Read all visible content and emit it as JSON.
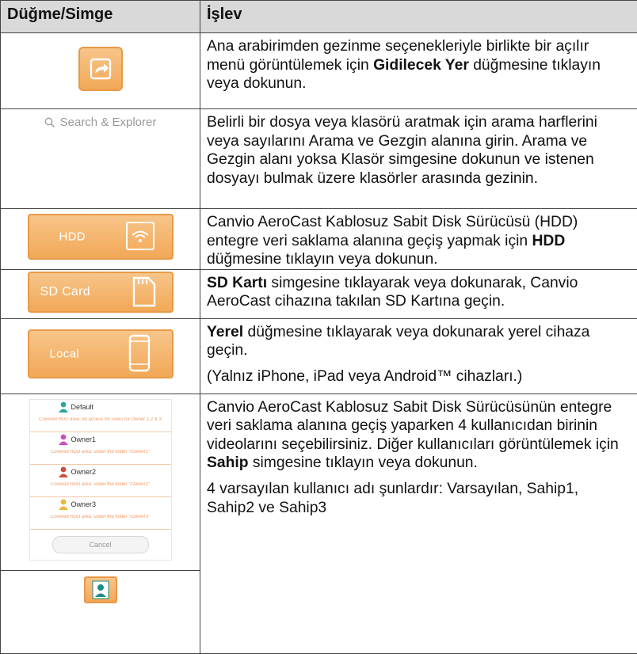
{
  "header": {
    "col1": "Düğme/Simge",
    "col2": "İşlev"
  },
  "rows": [
    {
      "pre": "Ana arabirimden gezinme seçenekleriyle birlikte bir açılır menü görüntülemek için ",
      "bold": "Gidilecek Yer",
      "post": " düğmesine tıklayın veya dokunun."
    },
    {
      "icon_label": "Search & Explorer",
      "text": "Belirli bir dosya veya klasörü aratmak için arama harflerini veya sayılarını Arama ve Gezgin alanına girin. Arama ve Gezgin alanı yoksa Klasör simgesine dokunun ve istenen dosyayı bulmak üzere klasörler arasında gezinin."
    },
    {
      "icon_label": "HDD",
      "pre": "Canvio AeroCast Kablosuz Sabit Disk Sürücüsü (HDD) entegre veri saklama alanına geçiş yapmak için ",
      "bold": "HDD",
      "post": " düğmesine tıklayın veya dokunun."
    },
    {
      "icon_label": "SD Card",
      "bold": "SD Kartı",
      "post": " simgesine tıklayarak veya dokunarak, Canvio AeroCast cihazına takılan SD Kartına geçin."
    },
    {
      "icon_label": "Local",
      "bold": "Yerel",
      "post": " düğmesine tıklayarak veya dokunarak yerel cihaza geçin.",
      "note": "(Yalnız iPhone, iPad veya Android™ cihazları.)"
    },
    {
      "owners": [
        {
          "name": "Default",
          "sub": "Covered HDD area: All access for users for Owner 1,2 & 3"
        },
        {
          "name": "Owner1",
          "sub": "Covered HDD area: under the folder \"/Owner1\""
        },
        {
          "name": "Owner2",
          "sub": "Covered HDD area: under the folder \"/Owner2\""
        },
        {
          "name": "Owner3",
          "sub": "Covered HDD area: under the folder \"/Owner3\""
        }
      ],
      "cancel": "Cancel",
      "pre": "Canvio AeroCast Kablosuz Sabit Disk Sürücüsünün entegre veri saklama alanına geçiş yaparken 4 kullanıcıdan birinin videolarını seçebilirsiniz. Diğer kullanıcıları görüntülemek için ",
      "bold": "Sahip",
      "post": " simgesine tıklayın veya dokunun.",
      "para2": "4 varsayılan kullanıcı adı şunlardır: Varsayılan, Sahip1, Sahip2 ve Sahip3"
    }
  ],
  "colors": {
    "orange": "#f2a857",
    "header_bg": "#d9d9d9",
    "owner_sub": "#f29a63"
  },
  "icons": [
    "share-arrow-icon",
    "search-icon",
    "wifi-drive-icon",
    "sd-card-icon",
    "phone-icon",
    "user-icon"
  ]
}
